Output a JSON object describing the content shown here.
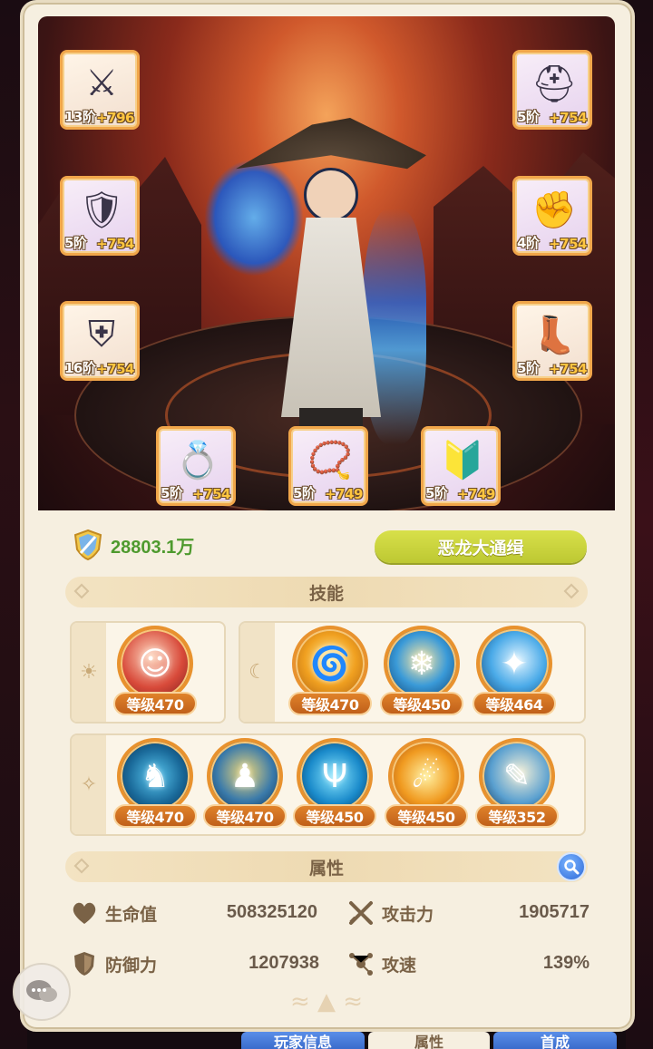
{
  "equipment": [
    {
      "id": "weapon",
      "icon": "sword-icon",
      "glyph": "⚔",
      "tier": "13阶",
      "plus": "+796",
      "style": "orange"
    },
    {
      "id": "helmet",
      "icon": "helmet-icon",
      "glyph": "⛑",
      "tier": "5阶",
      "plus": "+754",
      "style": "purple"
    },
    {
      "id": "armor",
      "icon": "armor-icon",
      "glyph": "🛡",
      "tier": "5阶",
      "plus": "+754",
      "style": "purple"
    },
    {
      "id": "gauntlet",
      "icon": "gauntlet-icon",
      "glyph": "✊",
      "tier": "4阶",
      "plus": "+754",
      "style": "purple"
    },
    {
      "id": "pants",
      "icon": "pants-icon",
      "glyph": "⛨",
      "tier": "16阶",
      "plus": "+754",
      "style": "orange"
    },
    {
      "id": "boots",
      "icon": "boots-icon",
      "glyph": "👢",
      "tier": "5阶",
      "plus": "+754",
      "style": "orange"
    },
    {
      "id": "ring",
      "icon": "ring-icon",
      "glyph": "💍",
      "tier": "5阶",
      "plus": "+754",
      "style": "purple"
    },
    {
      "id": "necklace",
      "icon": "necklace-icon",
      "glyph": "📿",
      "tier": "5阶",
      "plus": "+749",
      "style": "purple"
    },
    {
      "id": "amulet",
      "icon": "amulet-icon",
      "glyph": "🔰",
      "tier": "5阶",
      "plus": "+749",
      "style": "purple"
    }
  ],
  "power": {
    "icon": "shield-sword-icon",
    "value": "28803.1万"
  },
  "wanted_button": "恶龙大通缉",
  "skills_title": "技能",
  "skill_groups": [
    {
      "icon": "sun-icon",
      "glyph": "☀",
      "skills": [
        {
          "icon": "demon-face-icon",
          "level": "等级470",
          "color": "#b83a2a"
        }
      ]
    },
    {
      "icon": "moon-icon",
      "glyph": "☾",
      "skills": [
        {
          "icon": "whirlwind-icon",
          "level": "等级470",
          "color": "#d88a1a"
        },
        {
          "icon": "frost-figure-icon",
          "level": "等级450",
          "color": "#2a7ab8"
        },
        {
          "icon": "ice-claw-icon",
          "level": "等级464",
          "color": "#2a8ac8"
        }
      ]
    },
    {
      "icon": "sparkle-icon",
      "glyph": "✧",
      "skills": [
        {
          "icon": "beast-icon",
          "level": "等级470",
          "color": "#1a6a9a"
        },
        {
          "icon": "guardian-icon",
          "level": "等级470",
          "color": "#2a5a8a"
        },
        {
          "icon": "antler-icon",
          "level": "等级450",
          "color": "#1a7aaa"
        },
        {
          "icon": "fireball-icon",
          "level": "等级450",
          "color": "#e08a1a"
        },
        {
          "icon": "rune-scroll-icon",
          "level": "等级352",
          "color": "#2a6a9a"
        }
      ]
    }
  ],
  "attributes_title": "属性",
  "attributes": [
    {
      "icon": "heart-icon",
      "label": "生命值",
      "value": "508325120"
    },
    {
      "icon": "crossed-swords-icon",
      "label": "攻击力",
      "value": "1905717"
    },
    {
      "icon": "shield-icon",
      "label": "防御力",
      "value": "1207938"
    },
    {
      "icon": "speed-icon",
      "label": "攻速",
      "value": "139%"
    }
  ],
  "bottom_tabs": [
    "玩家信息",
    "属性",
    "首成"
  ]
}
